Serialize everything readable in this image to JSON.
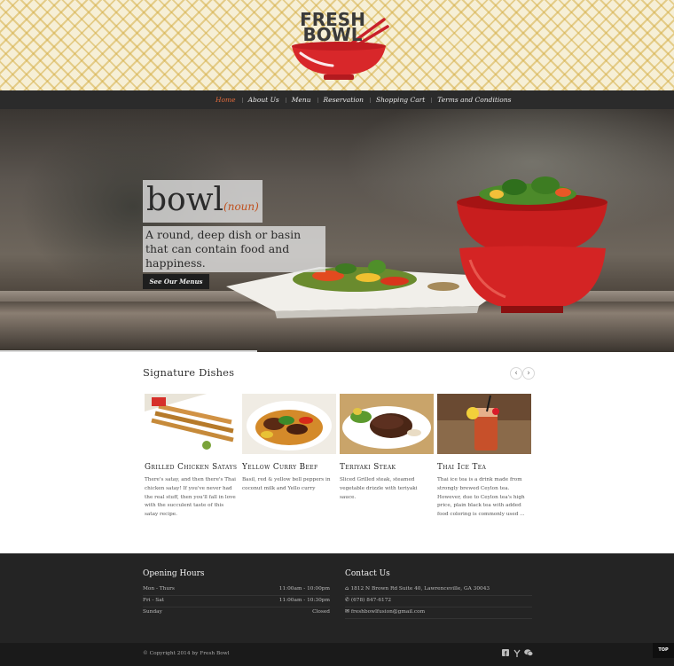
{
  "brand": {
    "line1": "FRESH",
    "line2": "BOWL"
  },
  "nav": {
    "items": [
      {
        "label": "Home",
        "active": true
      },
      {
        "label": "About Us"
      },
      {
        "label": "Menu"
      },
      {
        "label": "Reservation"
      },
      {
        "label": "Shopping Cart"
      },
      {
        "label": "Terms and Conditions"
      }
    ]
  },
  "hero": {
    "word": "bowl",
    "part_of_speech": "(noun)",
    "definition": "A round, deep dish or basin that can contain food and happiness.",
    "button_label": "See Our Menus"
  },
  "signature": {
    "title": "Signature Dishes",
    "prev_icon": "‹",
    "next_icon": "›",
    "dishes": [
      {
        "name": "Grilled Chicken Satays",
        "desc": "There's satay, and then there's Thai chicken satay! If you've never had the real stuff, then you'll fall in love with the succulent taste of this satay recipe."
      },
      {
        "name": "Yellow Curry Beef",
        "desc": "Basil, red & yellow bell peppers in coconut milk and Yello curry"
      },
      {
        "name": "Teriyaki Steak",
        "desc": "Sliced Grilled steak, steamed vegetable drizzle with teriyaki sauce."
      },
      {
        "name": "Thai Ice Tea",
        "desc": "Thai ice tea is a drink made from strongly brewed Ceylon tea. However, due to Ceylon tea's high price, plain black tea with added food coloring is commonly used ..."
      }
    ]
  },
  "footer": {
    "hours_title": "Opening Hours",
    "hours": [
      {
        "day": "Mon - Thurs",
        "time": "11:00am - 10:00pm"
      },
      {
        "day": "Fri - Sat",
        "time": "11:00am - 10:30pm"
      },
      {
        "day": "Sunday",
        "time": "Closed"
      }
    ],
    "contact_title": "Contact Us",
    "address": "1812 N Brown Rd Suite 40, Lawrenceville, GA 30043",
    "phone": "(678) 847-6172",
    "email": "freshbowlfusion@gmail.com",
    "copyright": "© Copyright 2014 by Fresh Bowl",
    "top_label": "TOP",
    "social_icons": [
      "facebook-icon",
      "yelp-icon",
      "wechat-icon"
    ]
  },
  "colors": {
    "accent": "#e06a3c",
    "nav_bg": "#2b2b2b",
    "footer_bg": "#242424",
    "bowl_red": "#d8272a"
  }
}
